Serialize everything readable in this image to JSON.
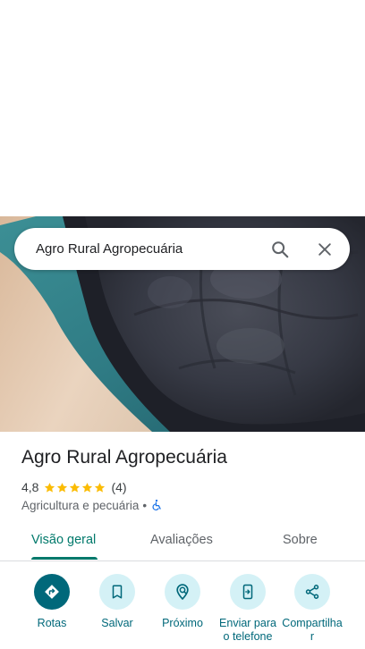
{
  "search": {
    "query": "Agro Rural Agropecuária"
  },
  "place": {
    "name": "Agro Rural Agropecuária",
    "rating": "4,8",
    "stars": 5,
    "review_count": "(4)",
    "category": "Agricultura e pecuária",
    "separator": "•"
  },
  "tabs": [
    {
      "label": "Visão geral",
      "active": true
    },
    {
      "label": "Avaliações",
      "active": false
    },
    {
      "label": "Sobre",
      "active": false
    }
  ],
  "actions": [
    {
      "label": "Rotas",
      "icon": "directions-icon"
    },
    {
      "label": "Salvar",
      "icon": "bookmark-icon"
    },
    {
      "label": "Próximo",
      "icon": "nearby-icon"
    },
    {
      "label": "Enviar para o telefone",
      "icon": "send-to-phone-icon"
    },
    {
      "label": "Compartilhar",
      "icon": "share-icon"
    }
  ],
  "colors": {
    "accent": "#00796b",
    "action_primary": "#00687a",
    "action_secondary_bg": "#d4f1f6",
    "star": "#fbbc04",
    "accessibility": "#1a73e8"
  }
}
